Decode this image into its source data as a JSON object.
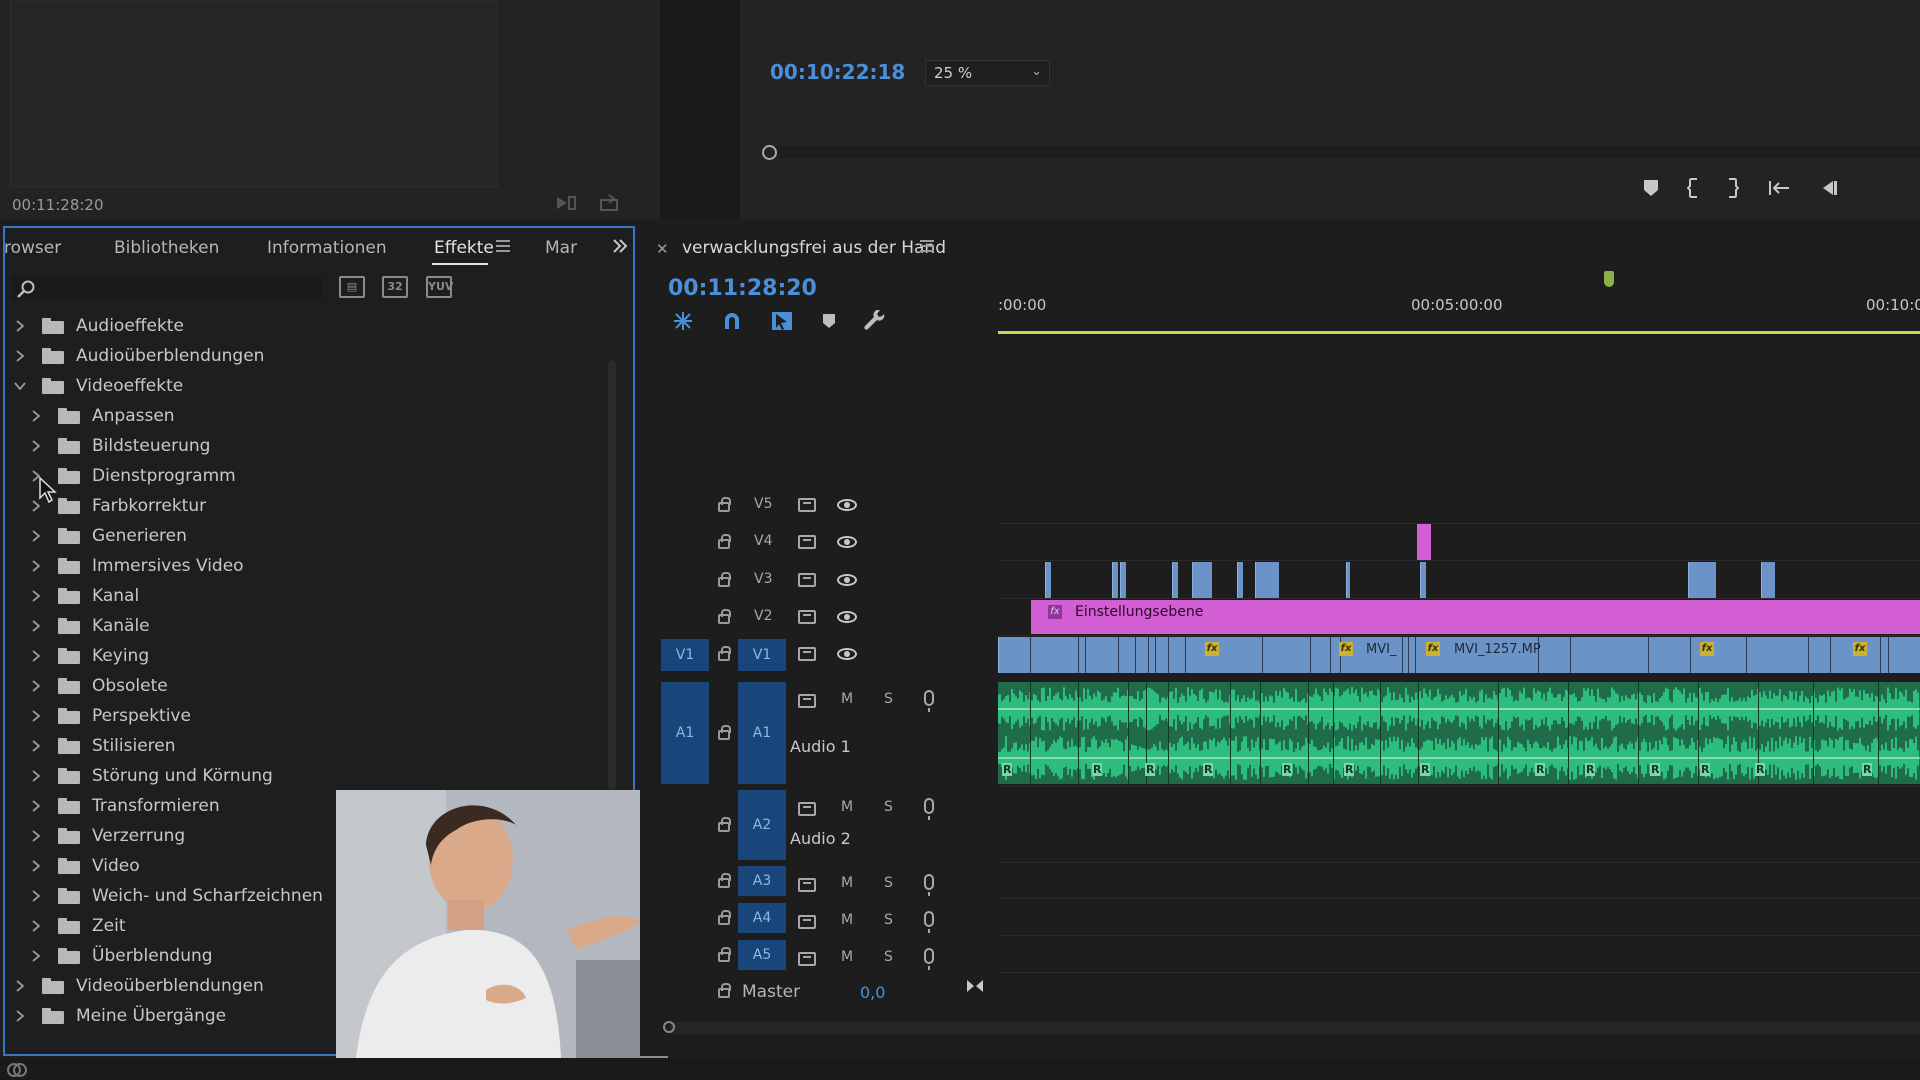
{
  "source_monitor": {
    "timecode": "00:11:28:20"
  },
  "program_monitor": {
    "timecode": "00:10:22:18",
    "zoom": "25 %"
  },
  "effects_panel": {
    "tabs": [
      "rowser",
      "Bibliotheken",
      "Informationen",
      "Effekte",
      "Mar"
    ],
    "active_tab": "Effekte",
    "search_placeholder": "",
    "filter_buttons": [
      "32",
      "YUV"
    ],
    "tree": [
      {
        "label": "Audioeffekte",
        "level": 0,
        "expanded": false
      },
      {
        "label": "Audioüberblendungen",
        "level": 0,
        "expanded": false
      },
      {
        "label": "Videoeffekte",
        "level": 0,
        "expanded": true
      },
      {
        "label": "Anpassen",
        "level": 1,
        "expanded": false
      },
      {
        "label": "Bildsteuerung",
        "level": 1,
        "expanded": false
      },
      {
        "label": "Dienstprogramm",
        "level": 1,
        "expanded": false
      },
      {
        "label": "Farbkorrektur",
        "level": 1,
        "expanded": false
      },
      {
        "label": "Generieren",
        "level": 1,
        "expanded": false
      },
      {
        "label": "Immersives Video",
        "level": 1,
        "expanded": false
      },
      {
        "label": "Kanal",
        "level": 1,
        "expanded": false
      },
      {
        "label": "Kanäle",
        "level": 1,
        "expanded": false
      },
      {
        "label": "Keying",
        "level": 1,
        "expanded": false
      },
      {
        "label": "Obsolete",
        "level": 1,
        "expanded": false
      },
      {
        "label": "Perspektive",
        "level": 1,
        "expanded": false
      },
      {
        "label": "Stilisieren",
        "level": 1,
        "expanded": false
      },
      {
        "label": "Störung und Körnung",
        "level": 1,
        "expanded": false
      },
      {
        "label": "Transformieren",
        "level": 1,
        "expanded": false
      },
      {
        "label": "Verzerrung",
        "level": 1,
        "expanded": false
      },
      {
        "label": "Video",
        "level": 1,
        "expanded": false
      },
      {
        "label": "Weich- und Scharfzeichnen",
        "level": 1,
        "expanded": false
      },
      {
        "label": "Zeit",
        "level": 1,
        "expanded": false
      },
      {
        "label": "Überblendung",
        "level": 1,
        "expanded": false
      },
      {
        "label": "Videoüberblendungen",
        "level": 0,
        "expanded": false
      },
      {
        "label": "Meine Übergänge",
        "level": 0,
        "expanded": false
      }
    ]
  },
  "timeline": {
    "sequence_name": "verwacklungsfrei aus der Hand",
    "timecode": "00:11:28:20",
    "ruler_labels": [
      ":00:00",
      "00:05:00:00",
      "00:10:0"
    ],
    "video_tracks": [
      "V5",
      "V4",
      "V3",
      "V2",
      "V1"
    ],
    "audio_tracks": [
      "A1",
      "A2",
      "A3",
      "A4",
      "A5"
    ],
    "source_patch_video": "V1",
    "source_patch_audio": "A1",
    "audio_track_names": {
      "A1": "Audio 1",
      "A2": "Audio 2"
    },
    "track_buttons": {
      "mute": "M",
      "solo": "S"
    },
    "clips": {
      "adjustment_layer": "Einstellungsebene",
      "v1_label_1": "MVI_",
      "v1_label_2": "MVI_1257.MP",
      "fx_badge": "fx",
      "audio_badge": "R"
    },
    "master": {
      "label": "Master",
      "value": "0,0"
    }
  },
  "colors": {
    "accent_blue": "#4a8fd8",
    "panel_focus": "#3b76c6",
    "clip_video": "#6b93c7",
    "clip_adjustment": "#d45fd4",
    "clip_audio": "#2fd28a",
    "work_area": "#cfd54a"
  },
  "icons": {
    "source_monitor": [
      "export-frame-icon",
      "insert-icon"
    ],
    "program_controls": [
      "add-marker-icon",
      "mark-in-icon",
      "mark-out-icon",
      "go-to-in-icon",
      "step-back-icon"
    ],
    "timeline_tools": [
      "nest-icon",
      "snap-magnet-icon",
      "linked-selection-icon",
      "marker-icon",
      "wrench-icon"
    ]
  }
}
